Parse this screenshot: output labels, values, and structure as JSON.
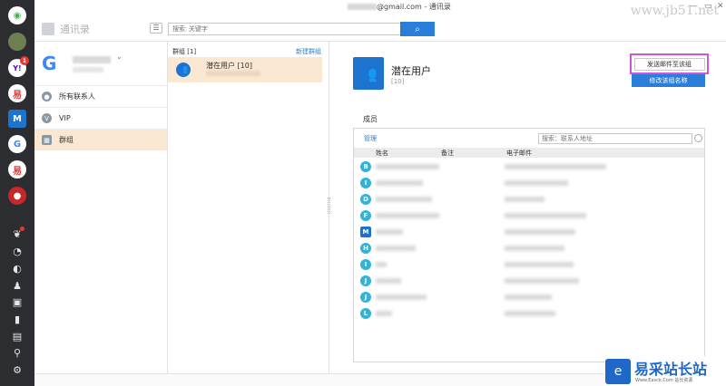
{
  "window": {
    "title_suffix": "@gmail.com - 通讯录",
    "minimize": "—",
    "restore": "▭",
    "close": "✕"
  },
  "watermark": {
    "top": "www.jb51.net",
    "brand": "易采站长站",
    "url": "Www.Easck.Com  站长资源"
  },
  "rail": {
    "apps": [
      {
        "icon": "colorful-app-icon",
        "glyph": "◉",
        "color": "#ffffff"
      },
      {
        "icon": "avatar-icon",
        "glyph": "",
        "color": "#6e7f52"
      },
      {
        "icon": "yahoo-icon",
        "glyph": "Y!",
        "color": "#ffffff",
        "badge": "1"
      },
      {
        "icon": "netease-icon",
        "glyph": "易",
        "color": "#e53935"
      },
      {
        "icon": "outlook-icon",
        "glyph": "M",
        "color": "#1e73cf"
      },
      {
        "icon": "google-icon",
        "glyph": "G",
        "color": "#ffffff"
      },
      {
        "icon": "netease-icon-2",
        "glyph": "易",
        "color": "#e53935"
      },
      {
        "icon": "red-app-icon",
        "glyph": "●",
        "color": "#c62828"
      }
    ],
    "tools": [
      "wechat-icon",
      "clock-icon",
      "compass-icon",
      "qq-icon",
      "notes-icon",
      "chart-icon",
      "files-icon",
      "attachment-icon",
      "settings-icon"
    ]
  },
  "toolbar": {
    "app_title": "通讯录",
    "menu_glyph": "☰",
    "search_placeholder": "搜索: 关键字",
    "search_glyph": "⌕"
  },
  "account": {
    "chevron": "⌄",
    "nav": [
      {
        "label": "所有联系人",
        "icon": "person-icon",
        "glyph": "👤",
        "active": false
      },
      {
        "label": "VIP",
        "icon": "vip-icon",
        "glyph": "V",
        "active": false
      },
      {
        "label": "群组",
        "icon": "group-icon",
        "glyph": "▦",
        "active": true
      }
    ]
  },
  "groups": {
    "header": "群组 [1]",
    "new_group": "新建群组",
    "items": [
      {
        "name": "潜在用户 [10]"
      }
    ]
  },
  "detail": {
    "title": "潜在用户",
    "count": "[10]",
    "send_button": "发送邮件至该组",
    "edit_button": "修改该组名称",
    "members_label": "成员",
    "manage": "管理",
    "member_search_placeholder": "搜索：联系人地址",
    "columns": [
      "姓名",
      "备注",
      "电子邮件"
    ],
    "rows": [
      {
        "letter": "B"
      },
      {
        "letter": "I"
      },
      {
        "letter": "D"
      },
      {
        "letter": "F"
      },
      {
        "letter": "M"
      },
      {
        "letter": "H"
      },
      {
        "letter": "I"
      },
      {
        "letter": "J"
      },
      {
        "letter": "J"
      },
      {
        "letter": "L"
      }
    ]
  }
}
